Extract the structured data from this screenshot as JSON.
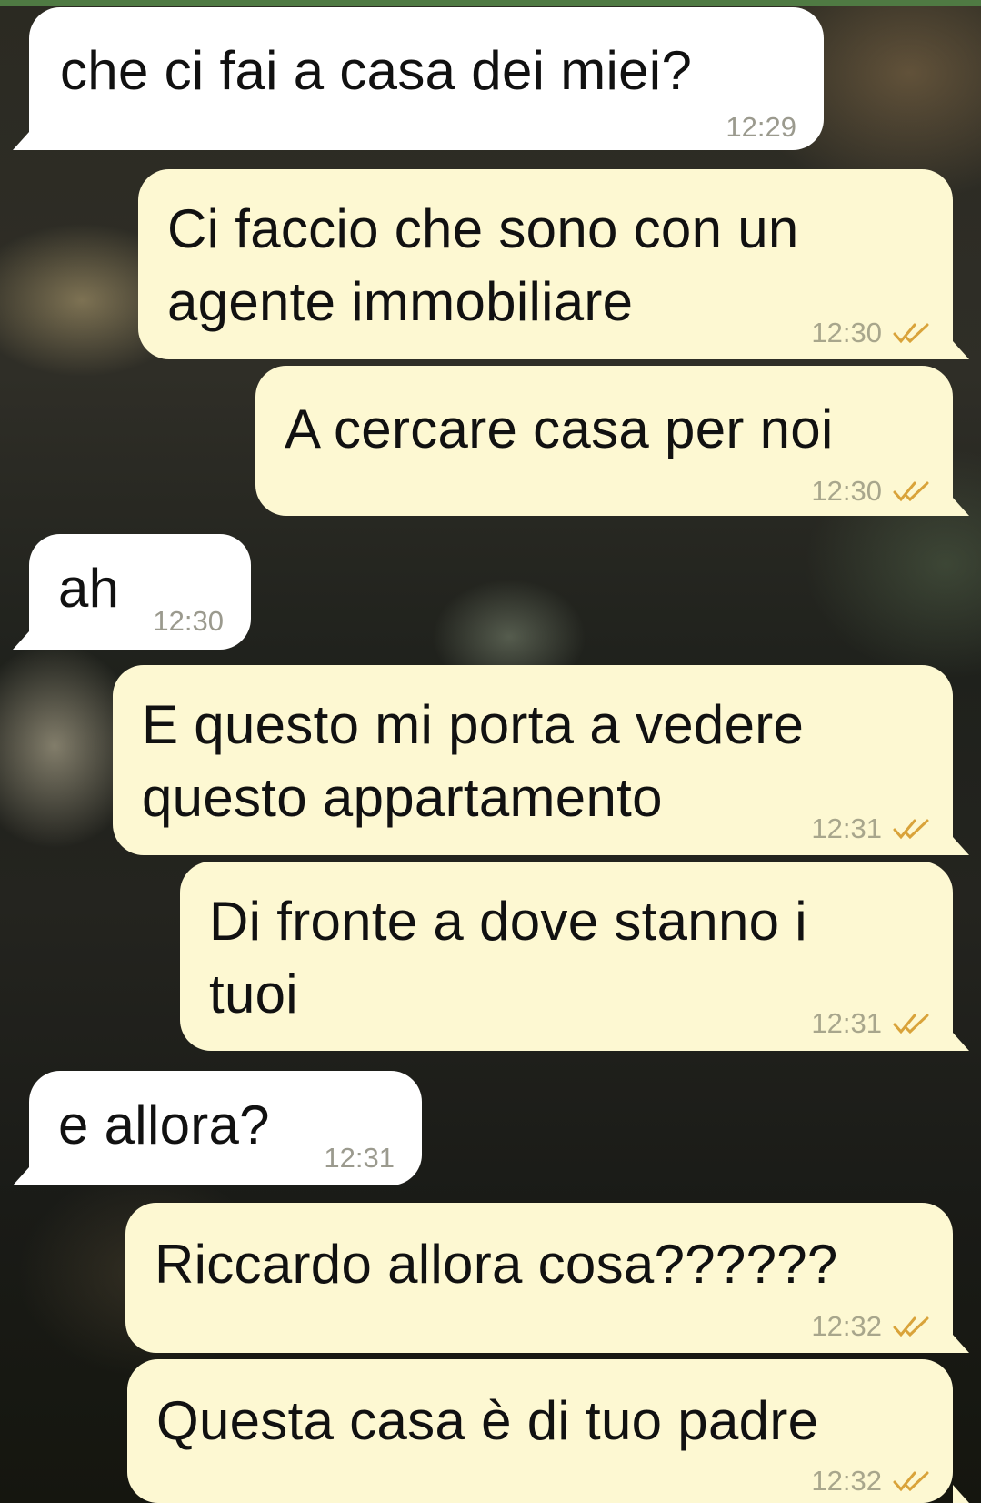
{
  "messages": [
    {
      "dir": "in",
      "text": "che ci fai a casa dei miei?",
      "time": "12:29"
    },
    {
      "dir": "out",
      "text": "Ci faccio che sono con un\nagente immobiliare",
      "time": "12:30",
      "status": "read-ticks-icon"
    },
    {
      "dir": "out",
      "text": "A cercare casa per noi",
      "time": "12:30",
      "status": "read-ticks-icon"
    },
    {
      "dir": "in",
      "text": "ah",
      "time": "12:30"
    },
    {
      "dir": "out",
      "text": "E questo mi porta a vedere\nquesto appartamento",
      "time": "12:31",
      "status": "read-ticks-icon"
    },
    {
      "dir": "out",
      "text": "Di fronte a dove stanno i\ntuoi",
      "time": "12:31",
      "status": "read-ticks-icon"
    },
    {
      "dir": "in",
      "text": "e allora?",
      "time": "12:31"
    },
    {
      "dir": "out",
      "text": "Riccardo allora cosa??????",
      "time": "12:32",
      "status": "read-ticks-icon"
    },
    {
      "dir": "out",
      "text": "Questa casa è di tuo padre",
      "time": "12:32",
      "status": "read-ticks-icon"
    }
  ],
  "colors": {
    "incoming_bubble": "#ffffff",
    "outgoing_bubble": "#fdf8d2",
    "timestamp": "#9b9a8e",
    "read_ticks": "#d9a33a",
    "top_bar": "#4f7a43"
  }
}
